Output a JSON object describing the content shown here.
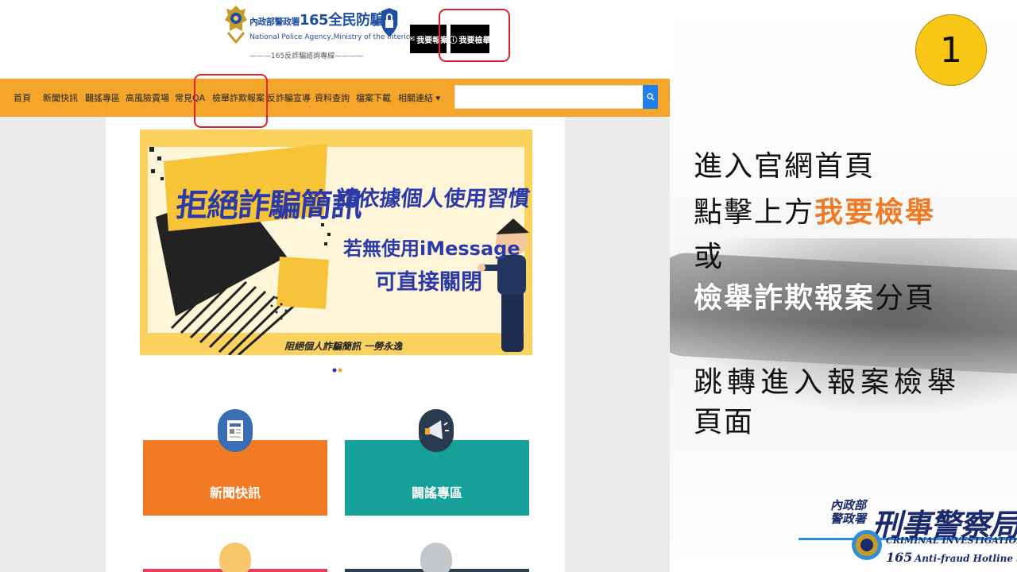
{
  "header": {
    "logo_agency": "內政部警政署",
    "logo_title": "165全民防騙網",
    "logo_english": "National Police Agency,Ministry of the Interior",
    "logo_sub": "165反詐騙諮詢專線",
    "report_button_label": "我要報案",
    "tip_button_label": "我要檢舉"
  },
  "nav": {
    "items": [
      "首頁",
      "新聞快訊",
      "闢謠專區",
      "高風險賣場",
      "常見QA",
      "檢舉詐欺報案",
      "反詐騙宣導",
      "資料查詢",
      "檔案下載",
      "相關連結"
    ],
    "dropdown_indicator": "▾",
    "search_placeholder": ""
  },
  "banner": {
    "headline": "拒絕詐騙簡訊",
    "line1": "請依據個人使用習慣",
    "line2": "若無使用iMessage",
    "line3": "可直接關閉",
    "footer": "阻絕個人詐騙簡訊 一勞永逸"
  },
  "tiles": [
    {
      "label": "新聞快訊",
      "icon": "newspaper-icon"
    },
    {
      "label": "闢謠專區",
      "icon": "megaphone-icon"
    }
  ],
  "instructions": {
    "step_number": "1",
    "line1": "進入官網首頁",
    "line2_prefix": "點擊上方",
    "line2_accent": "我要檢舉",
    "line3": "或",
    "line4_bold": "檢舉詐欺報案",
    "line4_suffix": "分頁",
    "line5": "跳轉進入報案檢舉",
    "line6": "頁面"
  },
  "logo_footer": {
    "agency_line1": "內政部",
    "agency_line2": "警政署",
    "name": "刑事警察局",
    "english": "CRIMINAL INVESTIGATION BUREAU",
    "hotline_number": "165",
    "hotline_text": "Anti-fraud Hotline Service"
  },
  "colors": {
    "nav_bg": "#f3a629",
    "highlight": "#e0202a",
    "accent": "#f07b26",
    "tile_news": "#f37a24",
    "tile_rumor": "#15a09a",
    "badge": "#f9c716"
  }
}
